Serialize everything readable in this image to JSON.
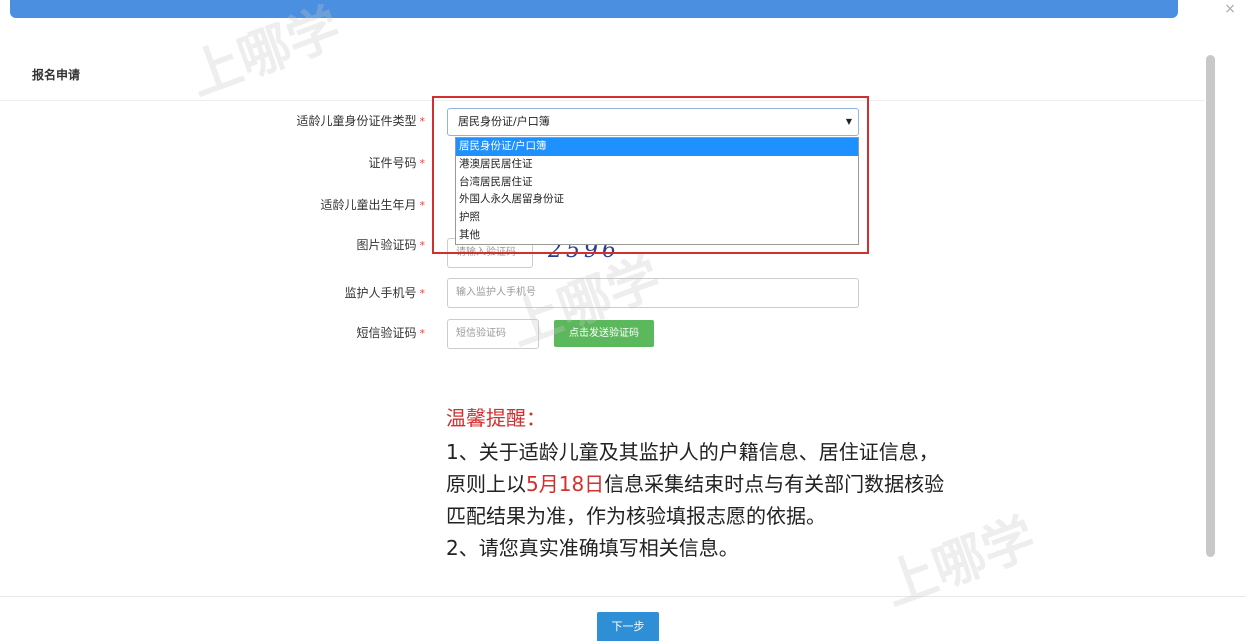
{
  "window": {
    "close_glyph": "×"
  },
  "section": {
    "title": "报名申请"
  },
  "form": {
    "required_mark": "*",
    "id_type": {
      "label": "适龄儿童身份证件类型",
      "selected": "居民身份证/户口簿",
      "options": [
        "居民身份证/户口簿",
        "港澳居民居住证",
        "台湾居民居住证",
        "外国人永久居留身份证",
        "护照",
        "其他"
      ]
    },
    "id_number": {
      "label": "证件号码"
    },
    "birth": {
      "label": "适龄儿童出生年月"
    },
    "captcha": {
      "label": "图片验证码",
      "placeholder": "请输入验证码",
      "image_text": "2596"
    },
    "phone": {
      "label": "监护人手机号",
      "placeholder": "输入监护人手机号"
    },
    "sms": {
      "label": "短信验证码",
      "placeholder": "短信验证码",
      "send_button": "点击发送验证码"
    }
  },
  "notice": {
    "title": "温馨提醒：",
    "line1": "1、关于适龄儿童及其监护人的户籍信息、居住证信息，",
    "line2_pre": "原则上以",
    "line2_date": "5月18日",
    "line2_post": "信息采集结束时点与有关部门数据核验",
    "line3": "匹配结果为准，作为核验填报志愿的依据。",
    "line4": "2、请您真实准确填写相关信息。"
  },
  "footer": {
    "next_button": "下一步"
  },
  "watermark": {
    "text": "上哪学"
  },
  "colors": {
    "accent": "#4a8fe0",
    "highlight": "#d32f2f",
    "sms_button": "#5cb85c",
    "next_button": "#2f8fd6"
  }
}
